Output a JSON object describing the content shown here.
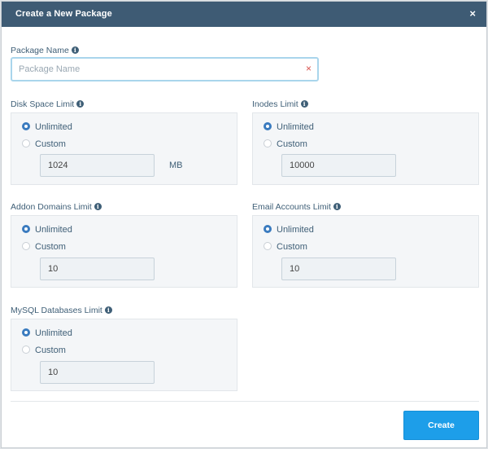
{
  "modal": {
    "title": "Create a New Package",
    "close_label": "×"
  },
  "package_name": {
    "label": "Package Name",
    "placeholder": "Package Name",
    "value": "",
    "clear_label": "×"
  },
  "options": {
    "unlimited": "Unlimited",
    "custom": "Custom"
  },
  "disk_space": {
    "label": "Disk Space Limit",
    "selected": "Unlimited",
    "value": "1024",
    "unit": "MB"
  },
  "inodes": {
    "label": "Inodes Limit",
    "selected": "Unlimited",
    "value": "10000"
  },
  "addon_domains": {
    "label": "Addon Domains Limit",
    "selected": "Unlimited",
    "value": "10"
  },
  "email_accounts": {
    "label": "Email Accounts Limit",
    "selected": "Unlimited",
    "value": "10"
  },
  "mysql_databases": {
    "label": "MySQL Databases Limit",
    "selected": "Unlimited",
    "value": "10"
  },
  "info_icon": "i",
  "footer": {
    "create_label": "Create"
  },
  "colors": {
    "header": "#3e5b74",
    "accent": "#1d9ee9",
    "label": "#3f5f77",
    "radio_checked": "#3a7bbf",
    "clear": "#d9534f"
  },
  "icons": [
    "close-icon",
    "info-icon",
    "clear-icon"
  ]
}
